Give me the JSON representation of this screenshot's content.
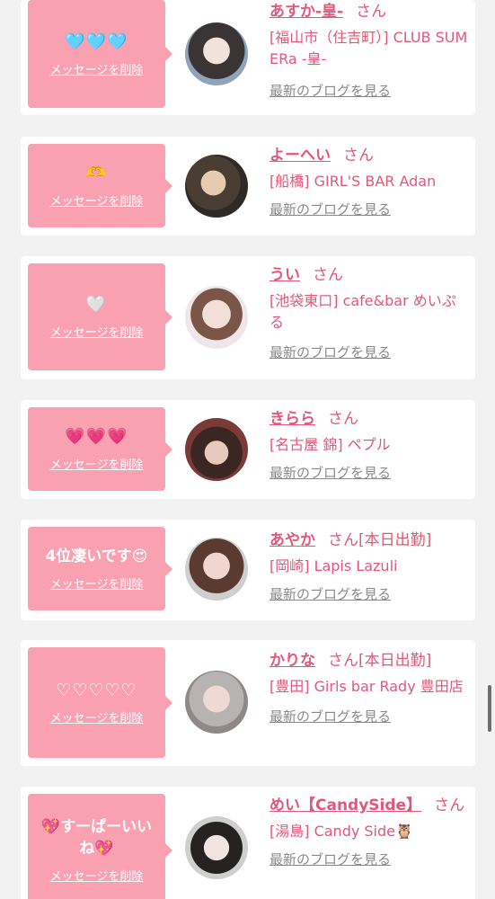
{
  "delete_label": "メッセージを削除",
  "blog_label": "最新のブログを見る",
  "san_label": "さん",
  "accent_color": "#e1587a",
  "bubble_color": "#f9a0b1",
  "entries": [
    {
      "message": "🩵🩵🩵",
      "name": "あすか-皇-",
      "san_suffix": "さん",
      "shop": "[福山市（住吉町）] CLUB SUMERa -皇-",
      "avatar": "avatar-asuka"
    },
    {
      "message": "🫶",
      "name": "よーへい",
      "san_suffix": "さん",
      "shop": "[船橋] GIRL'S BAR Adan",
      "avatar": "avatar-yohei"
    },
    {
      "message": "🤍",
      "name": "うい",
      "san_suffix": "さん",
      "shop": "[池袋東口] cafe&bar めいぷる",
      "avatar": "avatar-ui"
    },
    {
      "message": "💗💗💗",
      "name": "きらら",
      "san_suffix": "さん",
      "shop": "[名古屋 錦] ペプル",
      "avatar": "avatar-kirara"
    },
    {
      "message": "4位凄いです😍",
      "name": "あやか",
      "san_suffix": "さん[本日出勤]",
      "shop": "[岡崎] Lapis Lazuli",
      "avatar": "avatar-ayaka"
    },
    {
      "message": "♡♡♡♡♡",
      "name": "かりな",
      "san_suffix": "さん[本日出勤]",
      "shop": "[豊田] Girls bar Rady 豊田店",
      "avatar": "avatar-karina"
    },
    {
      "message": "💖すーぱーいいね💖",
      "name": "めい【CandySide】",
      "san_suffix": "さん",
      "shop": "[湯島] Candy Side🦉",
      "avatar": "avatar-mei"
    }
  ]
}
